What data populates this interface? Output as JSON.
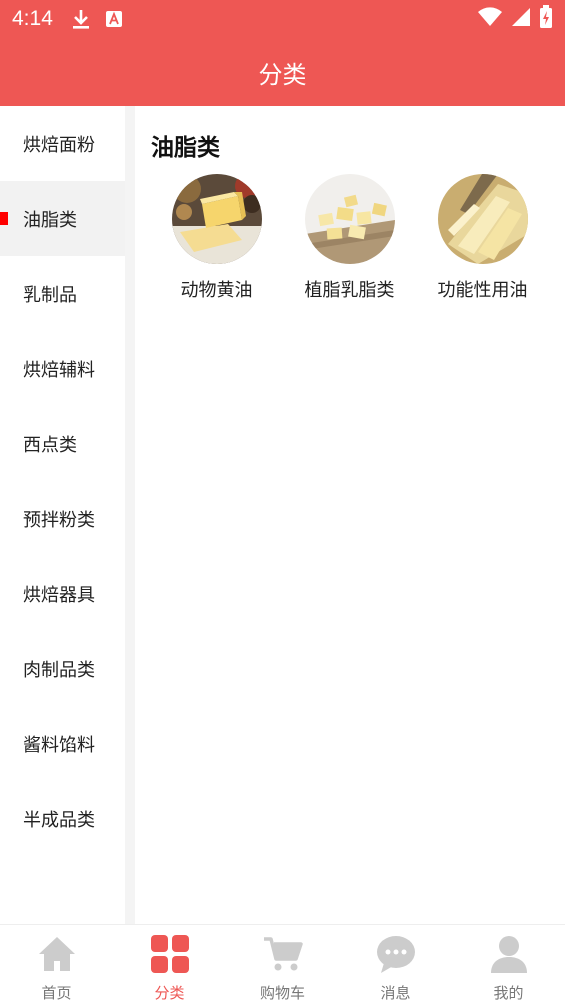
{
  "status_bar": {
    "time": "4:14",
    "icons": [
      "download-icon",
      "a-text-icon",
      "wifi-icon",
      "signal-icon",
      "battery-icon"
    ]
  },
  "header": {
    "title": "分类"
  },
  "sidebar": {
    "active_index": 1,
    "items": [
      {
        "label": "烘焙面粉"
      },
      {
        "label": "油脂类"
      },
      {
        "label": "乳制品"
      },
      {
        "label": "烘焙辅料"
      },
      {
        "label": "西点类"
      },
      {
        "label": "预拌粉类"
      },
      {
        "label": "烘焙器具"
      },
      {
        "label": "肉制品类"
      },
      {
        "label": "酱料馅料"
      },
      {
        "label": "半成品类"
      }
    ]
  },
  "main": {
    "section_title": "油脂类",
    "subcategories": [
      {
        "label": "动物黄油",
        "image": "butter-block-image"
      },
      {
        "label": "植脂乳脂类",
        "image": "butter-cubes-image"
      },
      {
        "label": "功能性用油",
        "image": "butter-slices-image"
      }
    ]
  },
  "tabbar": {
    "active_index": 1,
    "tabs": [
      {
        "label": "首页",
        "icon": "home-icon"
      },
      {
        "label": "分类",
        "icon": "grid-icon"
      },
      {
        "label": "购物车",
        "icon": "cart-icon"
      },
      {
        "label": "消息",
        "icon": "chat-icon"
      },
      {
        "label": "我的",
        "icon": "user-icon"
      }
    ]
  },
  "colors": {
    "primary": "#ee5754",
    "active_marker": "#ff0000",
    "tab_inactive": "#cccccc"
  }
}
